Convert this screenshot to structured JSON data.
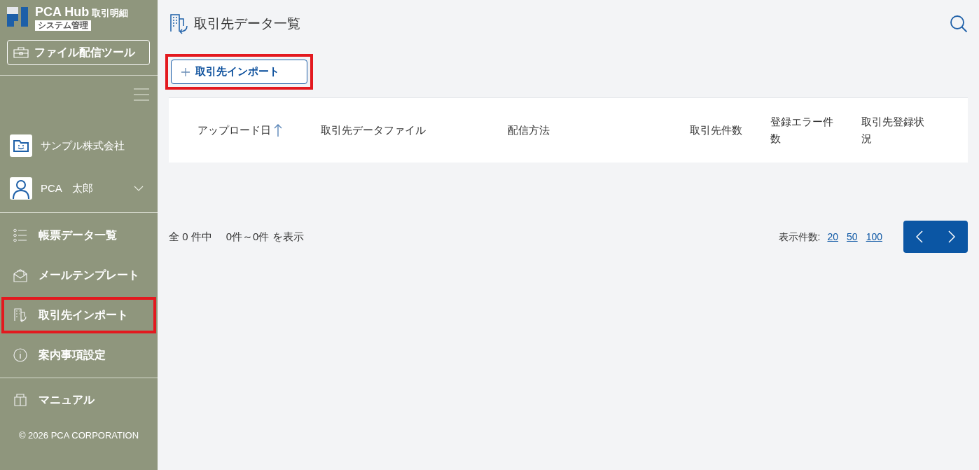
{
  "sidebar": {
    "logo": {
      "product": "PCA Hub",
      "edition": "取引明細",
      "badge": "システム管理"
    },
    "tool_button": "ファイル配信ツール",
    "company": "サンプル株式会社",
    "user": {
      "name": "PCA　太郎",
      "expanded": false
    },
    "nav_items": [
      {
        "label": "帳票データ一覧",
        "highlighted": false
      },
      {
        "label": "メールテンプレート",
        "highlighted": false
      },
      {
        "label": "取引先インポート",
        "highlighted": true
      },
      {
        "label": "案内事項設定",
        "highlighted": false
      }
    ],
    "manual": "マニュアル",
    "copyright": "© 2026 PCA CORPORATION"
  },
  "page_title": "取引先データ一覧",
  "import_button": {
    "label": "取引先インポート",
    "highlighted": true
  },
  "table": {
    "columns": [
      {
        "label": "アップロード日",
        "sorted": true
      },
      {
        "label": "取引先データファイル",
        "sorted": false
      },
      {
        "label": "配信方法",
        "sorted": false
      },
      {
        "label": "取引先件数",
        "sorted": false
      },
      {
        "label": "登録エラー件数",
        "sorted": false
      },
      {
        "label": "取引先登録状況",
        "sorted": false
      }
    ]
  },
  "summary": {
    "total": "全 0 件中",
    "range": "0件～0件 を表示"
  },
  "page_size": {
    "label": "表示件数:",
    "options": [
      "20",
      "50",
      "100"
    ]
  }
}
